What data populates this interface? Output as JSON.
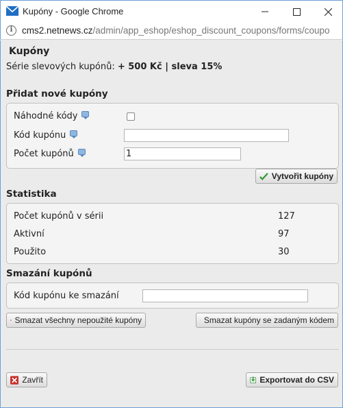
{
  "window": {
    "title": "Kupóny - Google Chrome",
    "url_domain": "cms2.netnews.cz",
    "url_path": "/admin/app_eshop/eshop_discount_coupons/forms/coupo"
  },
  "page": {
    "title": "Kupóny",
    "series_label": "Série slevových kupónů: ",
    "series_value": "+ 500 Kč | sleva 15%"
  },
  "add_section": {
    "heading": "Přidat nové kupóny",
    "random_codes_label": "Náhodné kódy",
    "coupon_code_label": "Kód kupónu",
    "coupon_code_value": "",
    "count_label": "Počet kupónů",
    "count_value": "1",
    "create_button": "Vytvořit kupóny"
  },
  "stats_section": {
    "heading": "Statistika",
    "rows": [
      {
        "label": "Počet kupónů v sérii",
        "value": "127"
      },
      {
        "label": "Aktivní",
        "value": "97"
      },
      {
        "label": "Použito",
        "value": "30"
      }
    ]
  },
  "delete_section": {
    "heading": "Smazání kupónů",
    "code_label": "Kód kupónu ke smazání",
    "code_value": "",
    "delete_unused_button": "Smazat všechny nepoužité kupóny",
    "delete_by_code_button": "Smazat kupóny se zadaným kódem"
  },
  "footer": {
    "close_button": "Zavřít",
    "export_button": "Exportovat do CSV"
  },
  "colors": {
    "window_border": "#6d9fd4",
    "panel_bg": "#f4f4f4",
    "content_bg": "#ebebeb"
  }
}
